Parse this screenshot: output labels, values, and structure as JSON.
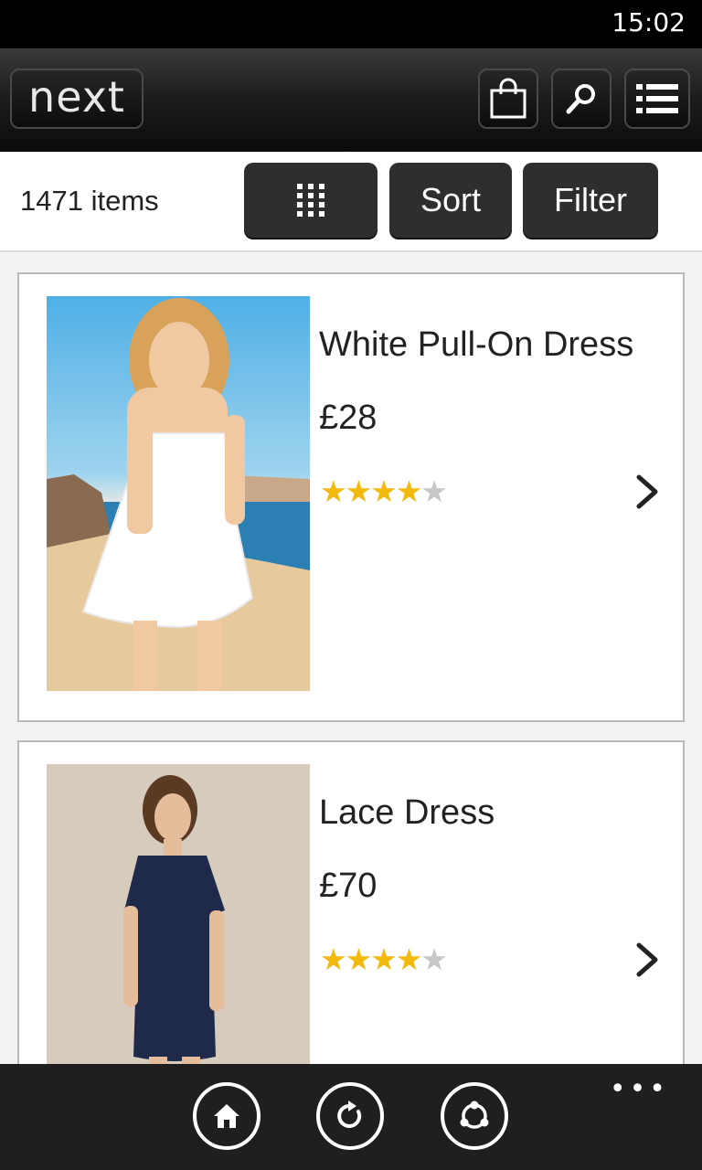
{
  "status_bar": {
    "time": "15:02"
  },
  "header": {
    "logo_text": "next",
    "buttons": [
      {
        "icon": "shopping-bag-icon"
      },
      {
        "icon": "search-icon"
      },
      {
        "icon": "menu-list-icon"
      }
    ]
  },
  "toolbar": {
    "item_count": "1471 items",
    "grid_view_icon": "grid-icon",
    "sort_label": "Sort",
    "filter_label": "Filter"
  },
  "products": [
    {
      "name": "White Pull-On Dress",
      "price": "£28",
      "rating": 4,
      "rating_max": 5
    },
    {
      "name": "Lace Dress",
      "price": "£70",
      "rating": 4,
      "rating_max": 5
    }
  ],
  "app_bar": {
    "buttons": [
      {
        "icon": "home-icon"
      },
      {
        "icon": "refresh-icon"
      },
      {
        "icon": "share-icon"
      }
    ],
    "more_label": "•••"
  },
  "colors": {
    "star_filled": "#f2b90f",
    "star_empty": "#c7c7c7",
    "button_dark": "#2e2e2e"
  }
}
